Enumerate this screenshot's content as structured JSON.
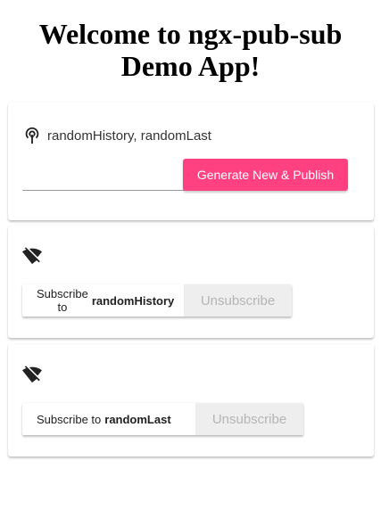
{
  "page": {
    "title": "Welcome to ngx-pub-sub Demo App!"
  },
  "publish_card": {
    "icon": "broadcast-icon",
    "channels_label": "randomHistory, randomLast",
    "input_value": "",
    "publish_button": "Generate New & Publish",
    "accent_color": "#ff4081"
  },
  "subscribers": [
    {
      "icon": "signal-off-icon",
      "subscribe_prefix": "Subscribe to",
      "channel": "randomHistory",
      "unsubscribe_label": "Unsubscribe"
    },
    {
      "icon": "signal-off-icon",
      "subscribe_prefix": "Subscribe to",
      "channel": "randomLast",
      "unsubscribe_label": "Unsubscribe"
    }
  ]
}
